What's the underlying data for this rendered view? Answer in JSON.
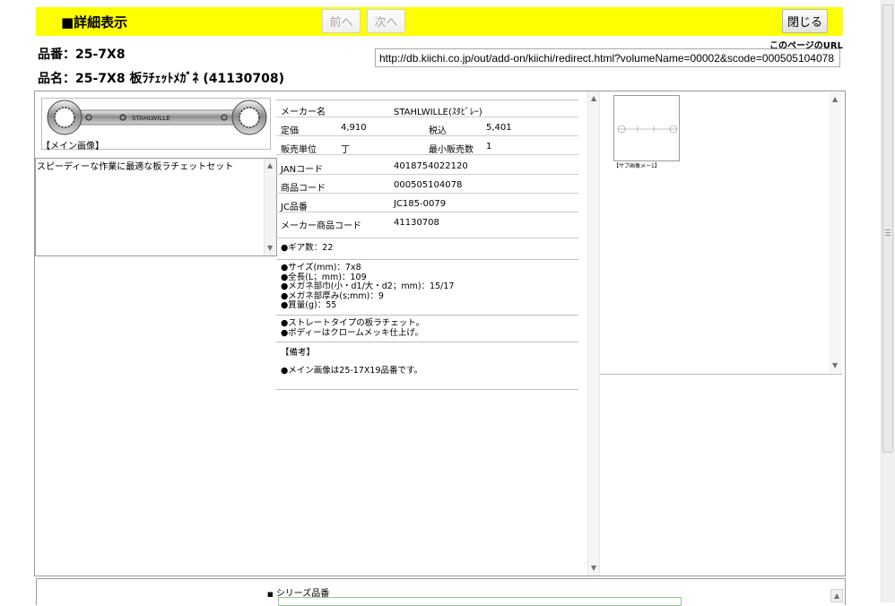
{
  "header": {
    "title": "■詳細表示",
    "prev_label": "前へ",
    "next_label": "次へ",
    "close_label": "閉じる"
  },
  "product": {
    "number_line": "品番：25-7X8",
    "name_line": "品名：25-7X8 板ﾗﾁｪｯﾄﾒｶﾞﾈ (41130708)"
  },
  "url": {
    "label": "このページのURL",
    "value": "http://db.kiichi.co.jp/out/add-on/kiichi/redirect.html?volumeName=00002&scode=000505104078"
  },
  "main_image": {
    "caption": "【メイン画像】",
    "engraving": "STAHLWILLE"
  },
  "description": "スピーディーな作業に最適な板ラチェットセット",
  "specs": {
    "maker_label": "メーカー名",
    "maker_value": "STAHLWILLE(ｽﾀﾋﾞﾚｰ)",
    "list_price_label": "定価",
    "list_price_value": "4,910",
    "tax_incl_label": "税込",
    "tax_incl_value": "5,401",
    "unit_label": "販売単位",
    "unit_value": "丁",
    "min_qty_label": "最小販売数",
    "min_qty_value": "1",
    "jan_label": "JANコード",
    "jan_value": "4018754022120",
    "item_code_label": "商品コード",
    "item_code_value": "000505104078",
    "jc_label": "JC品番",
    "jc_value": "JC185-0079",
    "maker_code_label": "メーカー商品コード",
    "maker_code_value": "41130708"
  },
  "notes": {
    "gear": "●ギア数：22",
    "size_lines": [
      "●サイズ(mm)：7x8",
      "●全長(L；mm)：109",
      "●メガネ部巾(小・d1/大・d2；mm)：15/17",
      "●メガネ部厚み(s;mm)：9",
      "●質量(g)：55"
    ],
    "feature_lines": [
      "●ストレートタイプの板ラチェット。",
      "●ボディーはクロームメッキ仕上げ。"
    ],
    "remarks_title": "【備考】",
    "remarks_line": "●メイン画像は25-17X19品番です。"
  },
  "sub_image": {
    "caption": "【サブ画像メー1】"
  },
  "series": {
    "label": "シリーズ品番"
  }
}
